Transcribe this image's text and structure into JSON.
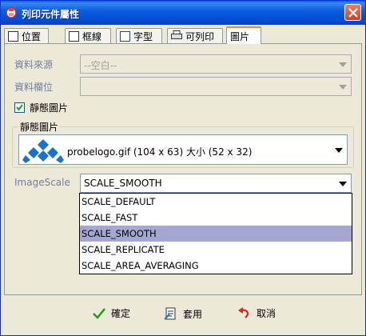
{
  "window": {
    "title": "列印元件屬性"
  },
  "tabs": [
    {
      "label": "位置",
      "icon": "position-icon"
    },
    {
      "label": "框線",
      "icon": "border-icon"
    },
    {
      "label": "字型",
      "icon": "font-icon"
    },
    {
      "label": "可列印",
      "icon": "printer-icon"
    },
    {
      "label": "圖片",
      "icon": ""
    }
  ],
  "fields": {
    "data_source_label": "資料來源",
    "data_source_value": "--空白--",
    "data_field_label": "資料欄位",
    "data_field_value": ""
  },
  "static_image": {
    "checkbox_label": "靜態圖片",
    "checked": true,
    "group_title": "靜態圖片",
    "image_text": "probelogo.gif  (104 x 63)  大小 (52 x 32)"
  },
  "image_scale": {
    "label": "ImageScale",
    "value": "SCALE_SMOOTH",
    "options": [
      "SCALE_DEFAULT",
      "SCALE_FAST",
      "SCALE_SMOOTH",
      "SCALE_REPLICATE",
      "SCALE_AREA_AVERAGING"
    ],
    "selected_index": 2
  },
  "buttons": {
    "ok": "確定",
    "apply": "套用",
    "cancel": "取消"
  },
  "colors": {
    "accent": "#0a5fde",
    "selection": "#a6a6d2",
    "logo": "#1a73c9"
  }
}
